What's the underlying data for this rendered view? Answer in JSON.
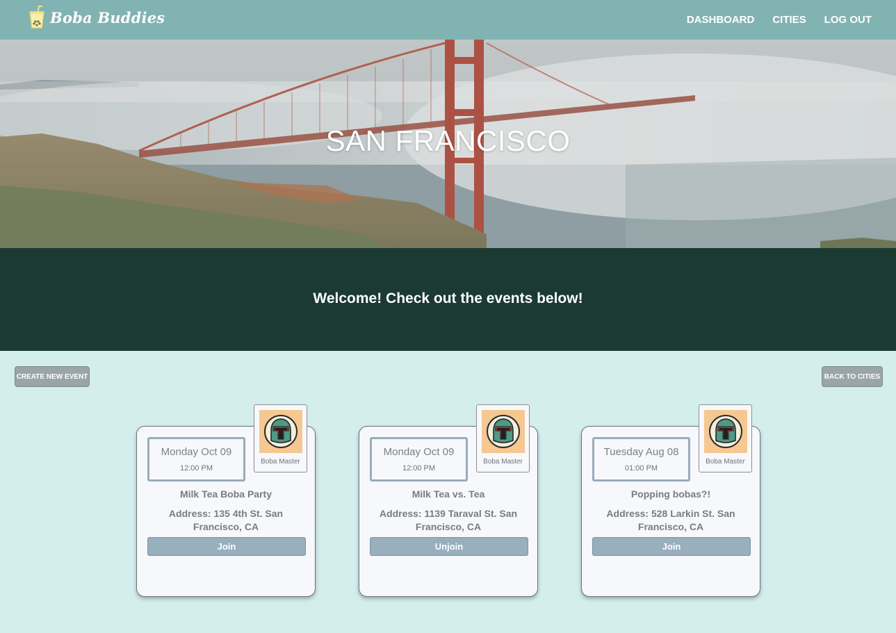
{
  "navbar": {
    "brand": "Boba Buddies",
    "links": [
      "DASHBOARD",
      "CITIES",
      "LOG OUT"
    ]
  },
  "hero": {
    "title": "SAN FRANCISCO"
  },
  "welcome": {
    "text": "Welcome! Check out the events below!"
  },
  "controls": {
    "create_label": "CREATE NEW EVENT",
    "back_label": "BACK TO CITIES"
  },
  "events": [
    {
      "date": "Monday Oct 09",
      "time": "12:00 PM",
      "host": "Boba Master",
      "title": "Milk Tea Boba Party",
      "address": "Address: 135 4th St. San Francisco, CA",
      "action": "Join"
    },
    {
      "date": "Monday Oct 09",
      "time": "12:00 PM",
      "host": "Boba Master",
      "title": "Milk Tea vs. Tea",
      "address": "Address: 1139 Taraval St. San Francisco, CA",
      "action": "Unjoin"
    },
    {
      "date": "Tuesday Aug 08",
      "time": "01:00 PM",
      "host": "Boba Master",
      "title": "Popping bobas?!",
      "address": "Address: 528 Larkin St. San Francisco, CA",
      "action": "Join"
    }
  ],
  "colors": {
    "navbar": "#82b3b3",
    "welcome_band": "#1a3a32",
    "page_background": "#d4eeee",
    "button": "#98afbd",
    "avatar_background": "#f5c892"
  },
  "icons": {
    "brand": "boba-cup-icon",
    "host_avatar": "helmet-avatar-icon"
  }
}
